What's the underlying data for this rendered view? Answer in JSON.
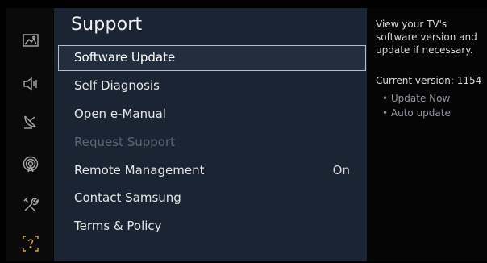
{
  "sidebar": {
    "items": [
      {
        "icon": "picture-icon"
      },
      {
        "icon": "sound-icon"
      },
      {
        "icon": "broadcasting-icon"
      },
      {
        "icon": "network-icon"
      },
      {
        "icon": "system-icon"
      },
      {
        "icon": "support-icon",
        "active": true
      }
    ],
    "active_color": "#d7a24a"
  },
  "main": {
    "title": "Support",
    "items": [
      {
        "label": "Software Update",
        "selected": true
      },
      {
        "label": "Self Diagnosis"
      },
      {
        "label": "Open e-Manual"
      },
      {
        "label": "Request Support",
        "disabled": true
      },
      {
        "label": "Remote Management",
        "value": "On"
      },
      {
        "label": "Contact Samsung"
      },
      {
        "label": "Terms & Policy"
      }
    ]
  },
  "help": {
    "description": "View your TV's software version and update if necessary.",
    "version": "Current version: 1154",
    "bullets": [
      "• Update Now",
      "• Auto update"
    ]
  }
}
